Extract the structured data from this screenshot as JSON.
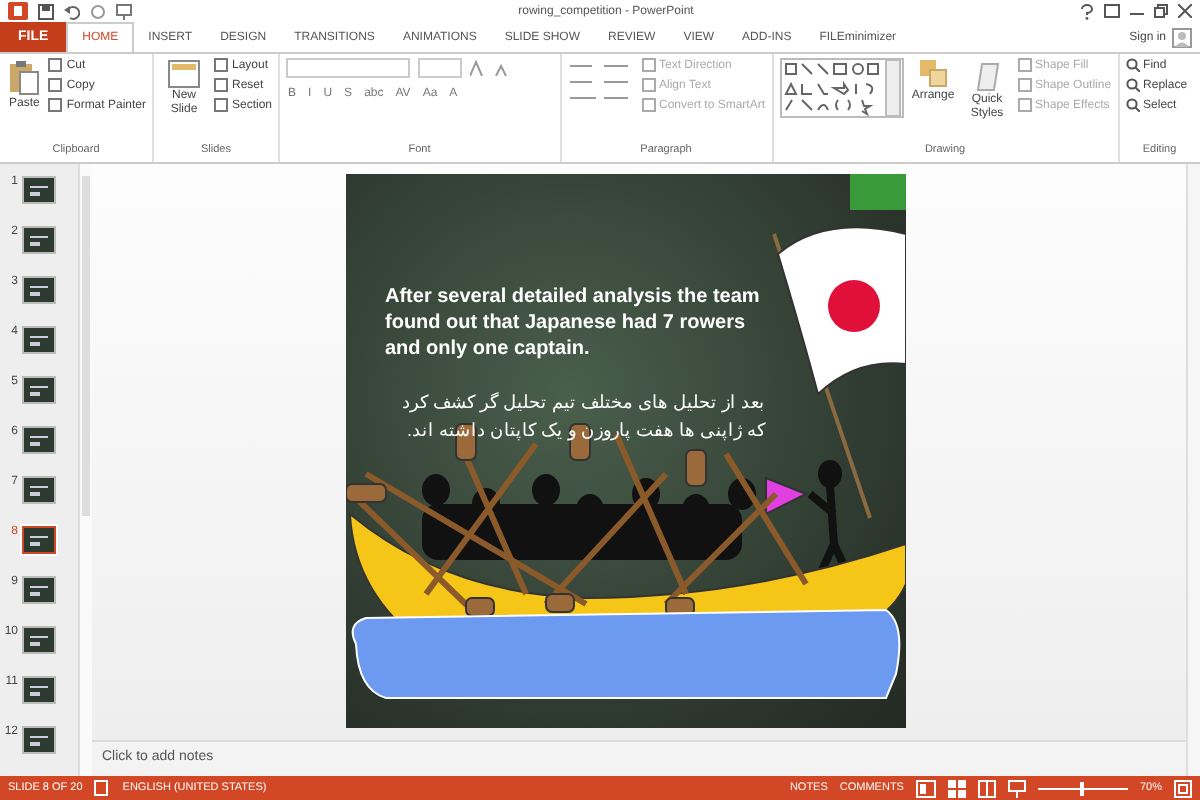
{
  "window": {
    "title": "rowing_competition - PowerPoint",
    "sign_in": "Sign in"
  },
  "file_tab": "FILE",
  "tabs": [
    {
      "label": "HOME",
      "selected": true
    },
    {
      "label": "INSERT",
      "selected": false
    },
    {
      "label": "DESIGN",
      "selected": false
    },
    {
      "label": "TRANSITIONS",
      "selected": false
    },
    {
      "label": "ANIMATIONS",
      "selected": false
    },
    {
      "label": "SLIDE SHOW",
      "selected": false
    },
    {
      "label": "REVIEW",
      "selected": false
    },
    {
      "label": "VIEW",
      "selected": false
    },
    {
      "label": "ADD-INS",
      "selected": false
    },
    {
      "label": "FILEminimizer",
      "selected": false
    }
  ],
  "ribbon": {
    "clipboard": {
      "label": "Clipboard",
      "paste": "Paste",
      "items": [
        {
          "label": "Cut"
        },
        {
          "label": "Copy"
        },
        {
          "label": "Format Painter"
        }
      ]
    },
    "slides": {
      "label": "Slides",
      "new_slide": "New Slide",
      "items": [
        {
          "label": "Layout"
        },
        {
          "label": "Reset"
        },
        {
          "label": "Section"
        }
      ]
    },
    "font": {
      "label": "Font",
      "buttons": [
        "B",
        "I",
        "U",
        "S",
        "abc",
        "AV",
        "Aa",
        "A"
      ]
    },
    "paragraph": {
      "label": "Paragraph",
      "items": [
        {
          "label": "Text Direction",
          "disabled": true
        },
        {
          "label": "Align Text",
          "disabled": true
        },
        {
          "label": "Convert to SmartArt",
          "disabled": true
        }
      ]
    },
    "drawing": {
      "label": "Drawing",
      "arrange": "Arrange",
      "quick_styles": "Quick Styles",
      "items": [
        {
          "label": "Shape Fill",
          "disabled": true
        },
        {
          "label": "Shape Outline",
          "disabled": true
        },
        {
          "label": "Shape Effects",
          "disabled": true
        }
      ]
    },
    "editing": {
      "label": "Editing",
      "items": [
        {
          "label": "Find"
        },
        {
          "label": "Replace"
        },
        {
          "label": "Select"
        }
      ]
    }
  },
  "thumbnails": [
    {
      "number": "1",
      "selected": false
    },
    {
      "number": "2",
      "selected": false
    },
    {
      "number": "3",
      "selected": false
    },
    {
      "number": "4",
      "selected": false
    },
    {
      "number": "5",
      "selected": false
    },
    {
      "number": "6",
      "selected": false
    },
    {
      "number": "7",
      "selected": false
    },
    {
      "number": "8",
      "selected": true
    },
    {
      "number": "9",
      "selected": false
    },
    {
      "number": "10",
      "selected": false
    },
    {
      "number": "11",
      "selected": false
    },
    {
      "number": "12",
      "selected": false
    }
  ],
  "slide": {
    "english_text": "After several detailed analysis the team found out that Japanese had 7 rowers and only one captain.",
    "persian_text": "بعد از تحلیل های مختلف تیم تحلیل گر کشف کرد که ژاپنی ها هفت پاروزن و یک کاپتان داشته اند."
  },
  "notes_placeholder": "Click to add notes",
  "status_bar": {
    "slide_count": "SLIDE 8 OF 20",
    "language": "ENGLISH (UNITED STATES)",
    "notes": "NOTES",
    "comments": "COMMENTS",
    "zoom": "70%",
    "zoom_slider": {
      "level": 0.5
    }
  }
}
